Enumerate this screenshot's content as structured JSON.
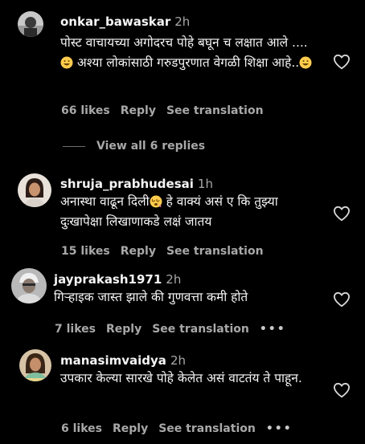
{
  "comments": [
    {
      "username": "onkar_bawaskar",
      "time": "2h",
      "text_part1": "पोस्ट वाचायच्या अगोदरच पोहे बघून च लक्षात आले ....",
      "text_part2": " अश्या लोकांसाठी गरुडपुरणात वेगळी शिक्षा आहे..",
      "likes": "66 likes",
      "reply": "Reply",
      "translate": "See translation",
      "emoji": "grinning-face"
    },
    {
      "username": "shruja_prabhudesai",
      "time": "1h",
      "text_part1": "अनास्था वाढून दिली",
      "text_part2": " हे वाक्यं असं ए कि तुझ्या दुःखापेक्षा लिखाणाकडे लक्षं जातय",
      "likes": "15 likes",
      "reply": "Reply",
      "translate": "See translation",
      "emoji": "face-with-spiral-eyes"
    },
    {
      "username": "jayprakash1971",
      "time": "2h",
      "text": "गिऱ्हाइक जास्त झाले की गुणवत्ता कमी होते",
      "likes": "7 likes",
      "reply": "Reply",
      "translate": "See translation",
      "more": "•••"
    },
    {
      "username": "manasimvaidya",
      "time": "2h",
      "text": "उपकार केल्या सारखे पोहे केलेत असं वाटतंय ते पाहून.",
      "likes": "6 likes",
      "reply": "Reply",
      "translate": "See translation",
      "more": "•••"
    }
  ],
  "view_replies": "View all 6 replies",
  "icons": {
    "like": "heart-outline-icon"
  },
  "colors": {
    "background": "#000000",
    "text": "#f5f5f5",
    "secondary": "#a8a8a8"
  }
}
